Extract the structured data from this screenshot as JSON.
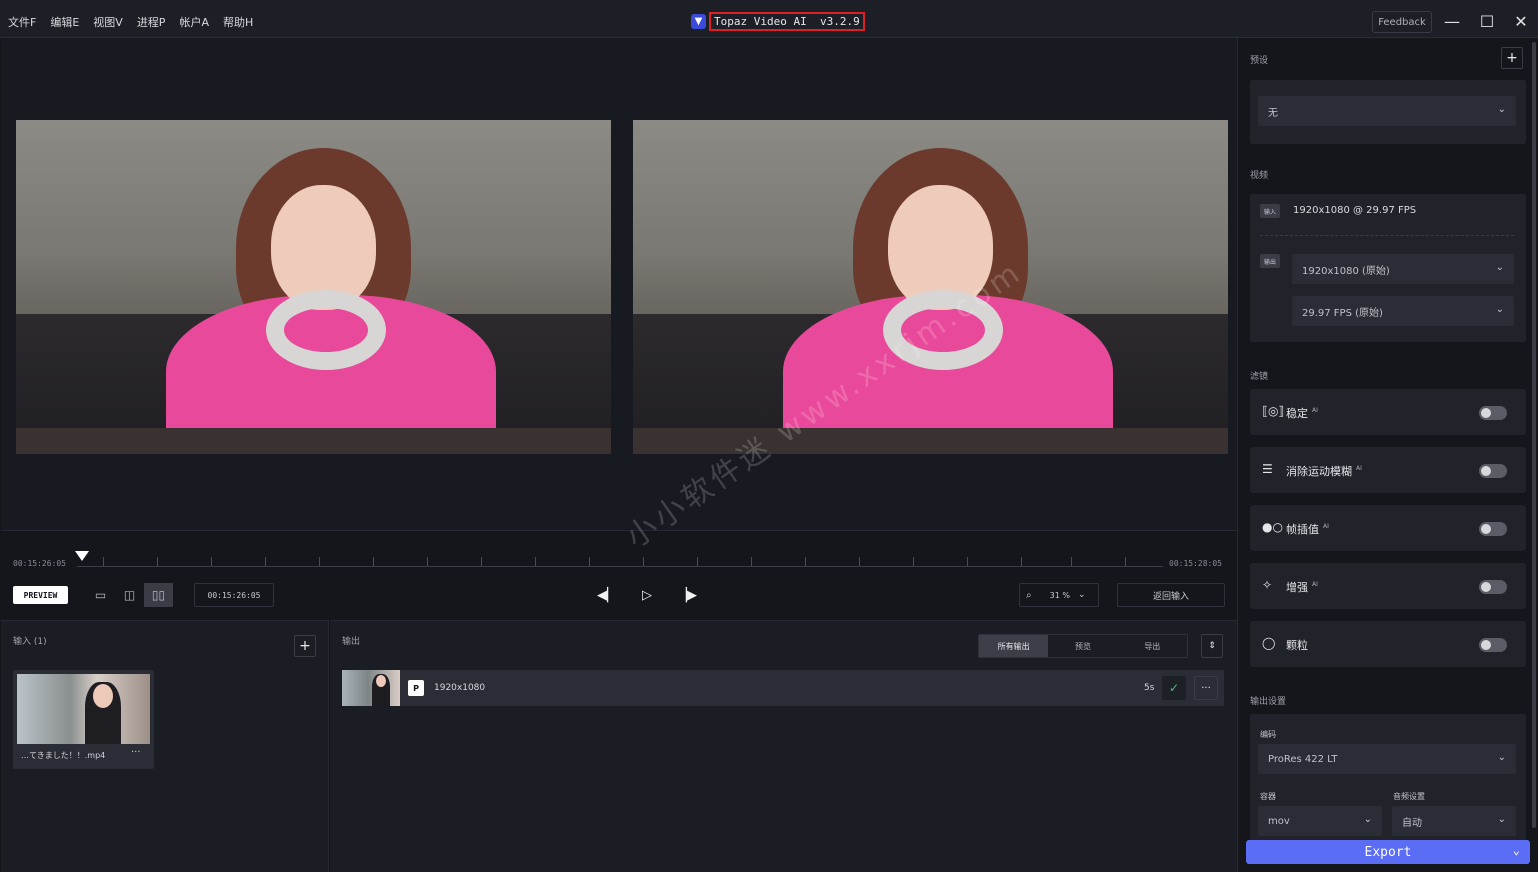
{
  "menu": [
    "文件F",
    "编辑E",
    "视图V",
    "进程P",
    "帐户A",
    "帮助H"
  ],
  "app": {
    "title": "Topaz Video AI  v3.2.9",
    "feedback": "Feedback"
  },
  "timeline": {
    "start_tc": "00:15:26:05",
    "end_tc": "00:15:28:05",
    "preview_label": "PREVIEW",
    "current_tc": "00:15:26:05",
    "zoom_value": "31 %",
    "return_label": "返回输入"
  },
  "inputs": {
    "title": "输入 (1)",
    "file_name": "…てきました！！.mp4"
  },
  "outputs": {
    "title": "输出",
    "tabs": [
      "所有输出",
      "预览",
      "导出"
    ],
    "row": {
      "badge": "P",
      "resolution": "1920x1080",
      "duration": "5s"
    }
  },
  "panel": {
    "preset_label": "预设",
    "preset_value": "无",
    "video_label": "视频",
    "input_badge": "输入",
    "input_spec": "1920x1080 @ 29.97 FPS",
    "output_badge": "输出",
    "output_resolution": "1920x1080 (原始)",
    "output_fps": "29.97 FPS (原始)",
    "filters_label": "滤镜",
    "filters": [
      {
        "name": "稳定",
        "ai": "AI"
      },
      {
        "name": "消除运动模糊",
        "ai": "AI"
      },
      {
        "name": "帧插值",
        "ai": "AI"
      },
      {
        "name": "增强",
        "ai": "AI"
      },
      {
        "name": "颗粒",
        "ai": ""
      }
    ],
    "output_settings_label": "输出设置",
    "codec_label": "编码",
    "codec_value": "ProRes 422 LT",
    "container_label": "容器",
    "container_value": "mov",
    "audio_label": "音频设置",
    "audio_value": "自动",
    "export_label": "Export"
  },
  "watermark": "小小软件迷 www.xxrjm.com"
}
